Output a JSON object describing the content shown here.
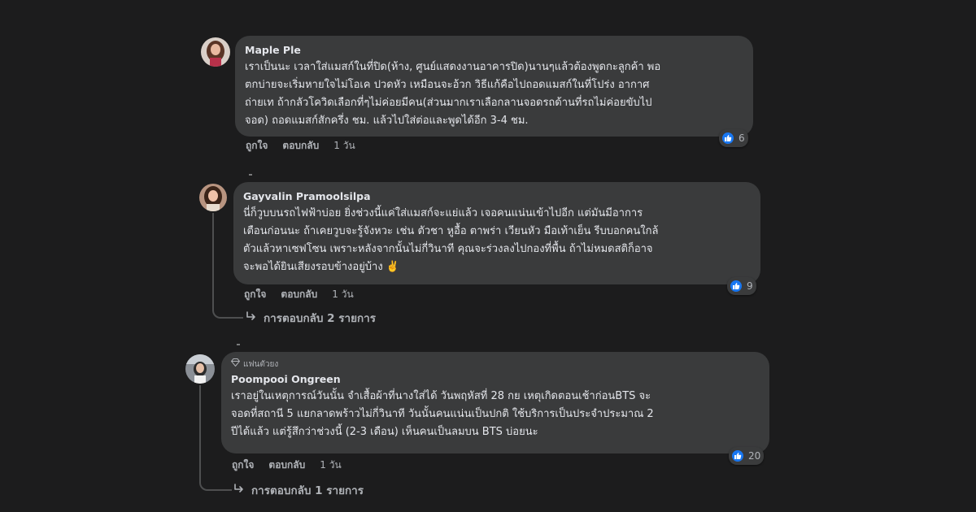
{
  "comments": [
    {
      "author": "Maple Ple",
      "text_lines": [
        "เราเป็นนะ เวลาใส่แมสก์ในที่ปิด(ห้าง, ศูนย์แสดงงานอาคารปิด)นานๆแล้วต้องพูดกะลูกค้า พอ",
        "ตกบ่ายจะเริ่มหายใจไม่โอเค ปวดหัว เหมือนจะอ้วก วิธีแก้คือไปถอดแมสก์ในที่โปร่ง อากาศ",
        "ถ่ายเท ถ้ากลัวโควิดเลือกที่ๆไม่ค่อยมีคน(ส่วนมากเราเลือกลานจอดรถด้านที่รถไม่ค่อยขับไป",
        "จอด) ถอดแมสก์สักครึ่ง ชม. แล้วไปใส่ต่อและพูดได้อีก 3-4 ชม."
      ],
      "reaction_count": "6",
      "like_label": "ถูกใจ",
      "reply_label": "ตอบกลับ",
      "time": "1 วัน"
    },
    {
      "author": "Gayvalin Pramoolsilpa",
      "text_lines": [
        "นี่ก็วูบบนรถไฟฟ้าบ่อย ยิ่งช่วงนี้แค่ใส่แมสก์จะแย่แล้ว เจอคนแน่นเข้าไปอีก แต่มันมีอาการ",
        "เตือนก่อนนะ ถ้าเคยวูบจะรู้จังหวะ เช่น ตัวชา หูอื้อ ตาพร่า เวียนหัว มือเท้าเย็น รีบบอกคนใกล้",
        "ตัวแล้วหาเซฟโซน เพราะหลังจากนั้นไม่กี่วินาที คุณจะร่วงลงไปกองที่พื้น ถ้าไม่หมดสติก็อาจ",
        "จะพอได้ยินเสียงรอบข้างอยู่บ้าง ✌️"
      ],
      "reaction_count": "9",
      "like_label": "ถูกใจ",
      "reply_label": "ตอบกลับ",
      "time": "1 วัน",
      "replies_label": "การตอบกลับ 2 รายการ"
    },
    {
      "badge": "แฟนตัวยง",
      "author": "Poompooi Ongreen",
      "text_lines": [
        "เราอยู่ในเหตุการณ์วันนั้น จำเสื้อผ้าที่นางใส่ได้ วันพฤหัสที่ 28 กย เหตุเกิดตอนเช้าก่อนBTS จะ",
        "จอดที่สถานี 5 แยกลาดพร้าวไม่กี่วินาที วันนั้นคนแน่นเป็นปกติ ใช้บริการเป็นประจำประมาณ 2",
        "ปีได้แล้ว แต่รู้สึกว่าช่วงนี้ (2-3 เดือน) เห็นคนเป็นลมบน BTS บ่อยนะ"
      ],
      "reaction_count": "20",
      "like_label": "ถูกใจ",
      "reply_label": "ตอบกลับ",
      "time": "1 วัน",
      "replies_label": "การตอบกลับ 1 รายการ"
    }
  ],
  "colors": {
    "background": "#1c1c1d",
    "bubble": "#3a3b3c",
    "text": "#e4e6eb",
    "secondary": "#b0b3b8",
    "like_blue": "#1877f2"
  },
  "icons": {
    "reaction": "thumbs-up-icon",
    "replies": "reply-arrow-icon",
    "badge": "diamond-icon"
  }
}
